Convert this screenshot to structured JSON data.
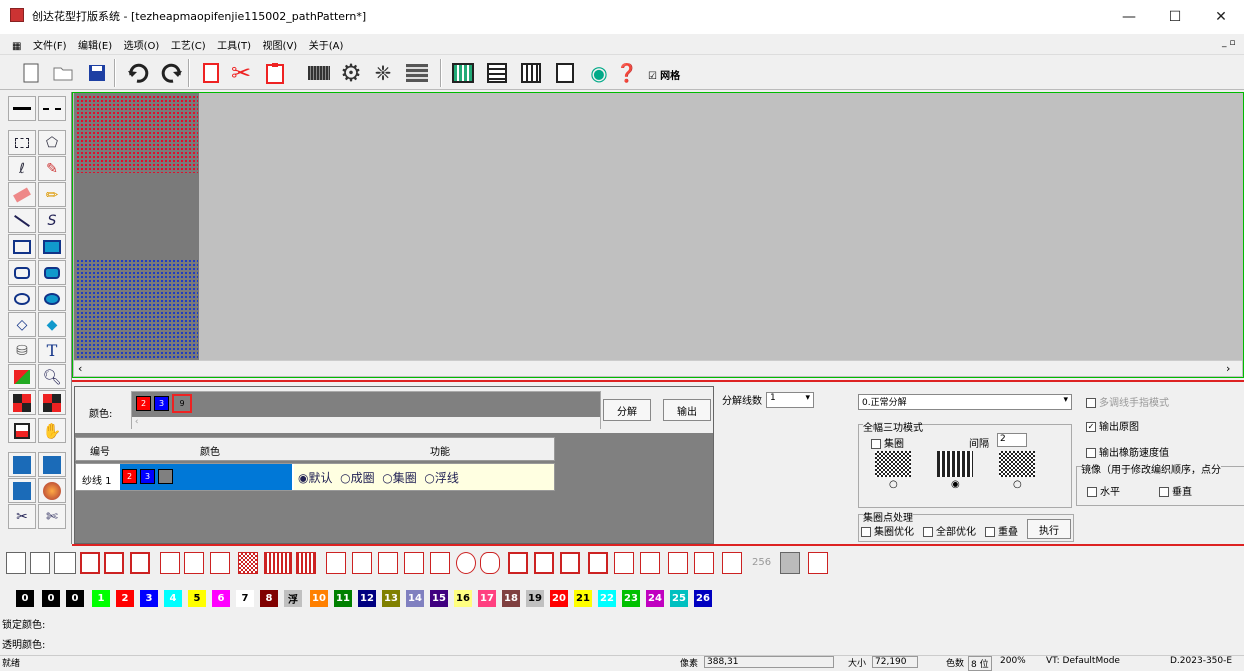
{
  "window": {
    "title": "创达花型打版系统 - [tezheapmaopifenjie115002_pathPattern*]",
    "minimize": "—",
    "maximize": "☐",
    "close": "✕"
  },
  "menu": [
    "文件(F)",
    "编辑(E)",
    "选项(O)",
    "工艺(C)",
    "工具(T)",
    "视图(V)",
    "关于(A)"
  ],
  "toolbar": {
    "grid_label": "网格",
    "grid_checked": "☑"
  },
  "panel": {
    "color_label": "颜色:",
    "colors": [
      {
        "num": "2",
        "color": "#ff0000"
      },
      {
        "num": "3",
        "color": "#0000ff"
      },
      {
        "num": "9",
        "color": "#808080"
      }
    ],
    "split_button": "分解",
    "output_button": "输出",
    "table_headers": {
      "num": "编号",
      "color": "颜色",
      "func": "功能"
    },
    "row_label": "纱线 1",
    "row_colors": [
      "2",
      "3",
      ""
    ],
    "radio_default": "默认",
    "radio_loop": "成圈",
    "radio_tuck": "集圈",
    "radio_float": "浮线",
    "split_count_label": "分解线数",
    "split_count_value": "1"
  },
  "right": {
    "mode_select": "0.正常分解",
    "multi_finger": "多调线手指模式",
    "output_original": "输出原图",
    "output_speed": "输出橡筋速度值",
    "full_three": "全幅三功模式",
    "tuck_label": "集圈",
    "gap_label": "间隔",
    "gap_value": "2",
    "mirror_label": "镜像（用于修改编织顺序，点分",
    "horizontal": "水平",
    "vertical": "垂直",
    "tuck_points": "集圈点处理",
    "tuck_opt": "集圈优化",
    "all_opt": "全部优化",
    "overlap": "重叠",
    "execute": "执行"
  },
  "shapebar": {
    "count_256": "256"
  },
  "palette": [
    {
      "n": "0",
      "c": "#000000"
    },
    {
      "n": "0",
      "c": "#000000"
    },
    {
      "n": "0",
      "c": "#000000"
    },
    {
      "n": "1",
      "c": "#00ff00"
    },
    {
      "n": "2",
      "c": "#ff0000"
    },
    {
      "n": "3",
      "c": "#0000ff"
    },
    {
      "n": "4",
      "c": "#00ffff"
    },
    {
      "n": "5",
      "c": "#ffff00"
    },
    {
      "n": "6",
      "c": "#ff00ff"
    },
    {
      "n": "7",
      "c": "#ffffff"
    },
    {
      "n": "8",
      "c": "#800000"
    },
    {
      "n": "浮",
      "c": "#c0c0c0"
    },
    {
      "n": "10",
      "c": "#ff8000"
    },
    {
      "n": "11",
      "c": "#008000"
    },
    {
      "n": "12",
      "c": "#000080"
    },
    {
      "n": "13",
      "c": "#808000"
    },
    {
      "n": "14",
      "c": "#8080c0"
    },
    {
      "n": "15",
      "c": "#400080"
    },
    {
      "n": "16",
      "c": "#ffff80"
    },
    {
      "n": "17",
      "c": "#ff4080"
    },
    {
      "n": "18",
      "c": "#804040"
    },
    {
      "n": "19",
      "c": "#c0c0c0"
    },
    {
      "n": "20",
      "c": "#ff0000"
    },
    {
      "n": "21",
      "c": "#ffff00"
    },
    {
      "n": "22",
      "c": "#00ffff"
    },
    {
      "n": "23",
      "c": "#00c000"
    },
    {
      "n": "24",
      "c": "#c000c0"
    },
    {
      "n": "25",
      "c": "#00c0c0"
    },
    {
      "n": "26",
      "c": "#0000c0"
    }
  ],
  "locked_color_label": "锁定颜色:",
  "transparent_color_label": "透明颜色:",
  "status": {
    "ready": "就绪",
    "pixel_label": "像素",
    "pixel_value": "388,31",
    "size_label": "大小",
    "size_value": "72,190",
    "colors_label": "色数",
    "colors_value": "8 位",
    "zoom": "200%",
    "vt_mode": "VT: DefaultMode",
    "version": "D.2023-350-E"
  }
}
